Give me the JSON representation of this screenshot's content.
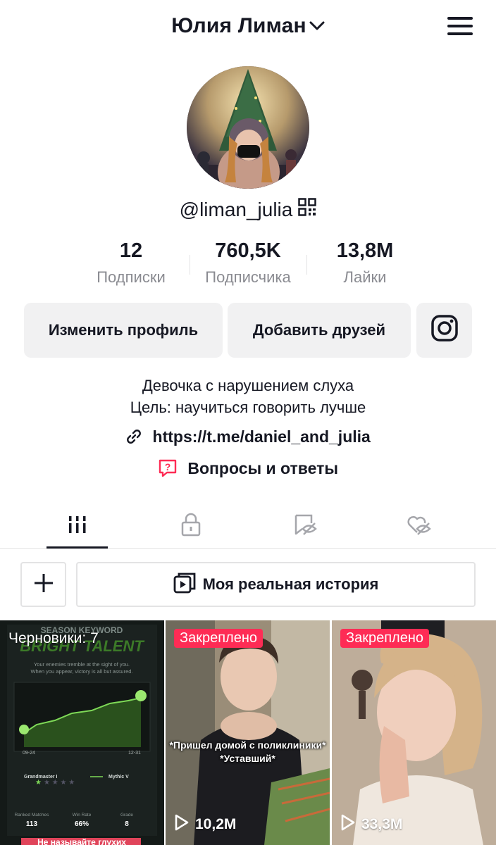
{
  "header": {
    "username": "Юлия Лиман",
    "icons": {
      "chevron": "chevron-down-icon",
      "menu": "hamburger-menu-icon"
    }
  },
  "profile": {
    "handle": "@liman_julia",
    "handle_icon": "qr-code-icon"
  },
  "stats": [
    {
      "value": "12",
      "label": "Подписки"
    },
    {
      "value": "760,5K",
      "label": "Подписчика"
    },
    {
      "value": "13,8M",
      "label": "Лайки"
    }
  ],
  "buttons": {
    "edit_profile": "Изменить профиль",
    "add_friends": "Добавить друзей",
    "instagram_icon": "instagram-icon"
  },
  "bio": {
    "line1": "Девочка с нарушением слуха",
    "line2": "Цель: научиться говорить лучше",
    "link": "https://t.me/daniel_and_julia",
    "qa": "Вопросы и ответы"
  },
  "tabs": [
    {
      "icon": "grid-videos-icon",
      "active": true
    },
    {
      "icon": "lock-icon",
      "active": false
    },
    {
      "icon": "hidden-saved-icon",
      "active": false
    },
    {
      "icon": "hidden-liked-icon",
      "active": false
    }
  ],
  "story": {
    "add_icon": "plus-icon",
    "label": "Моя реальная история",
    "icon": "playlist-icon"
  },
  "videos": [
    {
      "overlay": "Черновики: 7",
      "thumb": {
        "title1": "SEASON KEYWORD",
        "title2": "BRIGHT TALENT",
        "subtitle1": "Your enemies tremble at the sight of you.",
        "subtitle2": "When you appear, victory is all but assured.",
        "date_start": "09-24",
        "date_end": "12-31",
        "rank_from": "Grandmaster I",
        "rank_to": "Mythic V",
        "stats": [
          {
            "label": "Ranked Matches",
            "value": "113"
          },
          {
            "label": "Win Rate",
            "value": "66%"
          },
          {
            "label": "Grade",
            "value": "8"
          }
        ]
      },
      "bottom_text": "Не называйте глухих"
    },
    {
      "pinned": "Закреплено",
      "views": "10,2M",
      "caption1": "*Пришел домой с поликлиники*",
      "caption2": "*Уставший*"
    },
    {
      "pinned": "Закреплено",
      "views": "33,3M"
    }
  ],
  "colors": {
    "accent": "#fe2c55",
    "text": "#161823",
    "muted": "#8a8b91",
    "button_bg": "#f1f1f2"
  }
}
